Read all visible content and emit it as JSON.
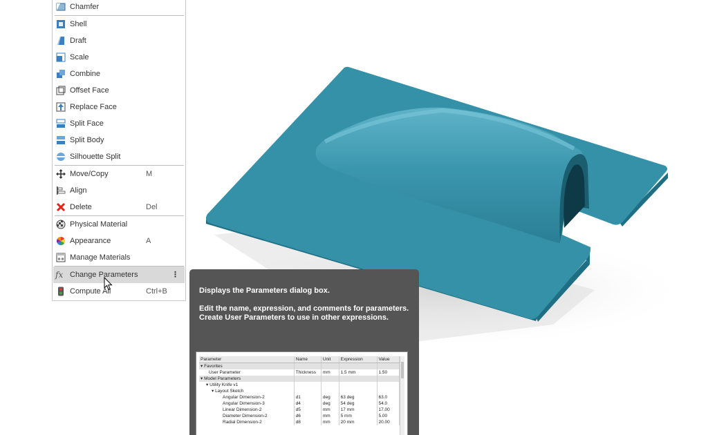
{
  "menu": {
    "items": [
      {
        "label": "Chamfer",
        "shortcut": "",
        "icon": "chamfer-icon"
      },
      {
        "label": "Shell",
        "shortcut": "",
        "icon": "shell-icon"
      },
      {
        "label": "Draft",
        "shortcut": "",
        "icon": "draft-icon"
      },
      {
        "label": "Scale",
        "shortcut": "",
        "icon": "scale-icon"
      },
      {
        "label": "Combine",
        "shortcut": "",
        "icon": "combine-icon"
      },
      {
        "label": "Offset Face",
        "shortcut": "",
        "icon": "offset-face-icon"
      },
      {
        "label": "Replace Face",
        "shortcut": "",
        "icon": "replace-face-icon"
      },
      {
        "label": "Split Face",
        "shortcut": "",
        "icon": "split-face-icon"
      },
      {
        "label": "Split Body",
        "shortcut": "",
        "icon": "split-body-icon"
      },
      {
        "label": "Silhouette Split",
        "shortcut": "",
        "icon": "silhouette-split-icon"
      },
      {
        "label": "Move/Copy",
        "shortcut": "M",
        "icon": "move-icon"
      },
      {
        "label": "Align",
        "shortcut": "",
        "icon": "align-icon"
      },
      {
        "label": "Delete",
        "shortcut": "Del",
        "icon": "delete-icon"
      },
      {
        "label": "Physical Material",
        "shortcut": "",
        "icon": "physical-material-icon"
      },
      {
        "label": "Appearance",
        "shortcut": "A",
        "icon": "appearance-icon"
      },
      {
        "label": "Manage Materials",
        "shortcut": "",
        "icon": "manage-materials-icon"
      },
      {
        "label": "Change Parameters",
        "shortcut": "",
        "icon": "fx-icon"
      },
      {
        "label": "Compute All",
        "shortcut": "Ctrl+B",
        "icon": "compute-icon"
      }
    ],
    "more_glyph": "⋮"
  },
  "tooltip": {
    "title": "Displays the Parameters dialog box.",
    "body": "Edit the name, expression, and comments for parameters. Create User Parameters to use in other expressions."
  },
  "preview": {
    "headers": [
      "Parameter",
      "Name",
      "Unit",
      "Expression",
      "Value"
    ],
    "rows": [
      {
        "p": "▾ Favorites",
        "n": "",
        "u": "",
        "e": "",
        "v": "",
        "group": true
      },
      {
        "p": "User Parameter",
        "n": "Thickness",
        "u": "mm",
        "e": "1.5 mm",
        "v": "1.50",
        "group": false
      },
      {
        "p": "▾ Model Parameters",
        "n": "",
        "u": "",
        "e": "",
        "v": "",
        "group": true
      },
      {
        "p": "▾ Utility Knife v1",
        "n": "",
        "u": "",
        "e": "",
        "v": "",
        "group": false
      },
      {
        "p": "▾ Layout Sketch",
        "n": "",
        "u": "",
        "e": "",
        "v": "",
        "group": false
      },
      {
        "p": "Angular Dimension-2",
        "n": "d1",
        "u": "deg",
        "e": "63 deg",
        "v": "63.0",
        "group": false
      },
      {
        "p": "Angular Dimension-3",
        "n": "d4",
        "u": "deg",
        "e": "54 deg",
        "v": "54.0",
        "group": false
      },
      {
        "p": "Linear Dimension-2",
        "n": "d5",
        "u": "mm",
        "e": "17 mm",
        "v": "17.00",
        "group": false
      },
      {
        "p": "Diameter Dimension-2",
        "n": "d6",
        "u": "mm",
        "e": "5 mm",
        "v": "5.00",
        "group": false
      },
      {
        "p": "Radial Dimension-2",
        "n": "d8",
        "u": "mm",
        "e": "20 mm",
        "v": "20.00",
        "group": false
      }
    ]
  },
  "colors": {
    "model": "#3591a8",
    "tooltip_bg": "#555555",
    "highlight": "#d9d9d9"
  }
}
